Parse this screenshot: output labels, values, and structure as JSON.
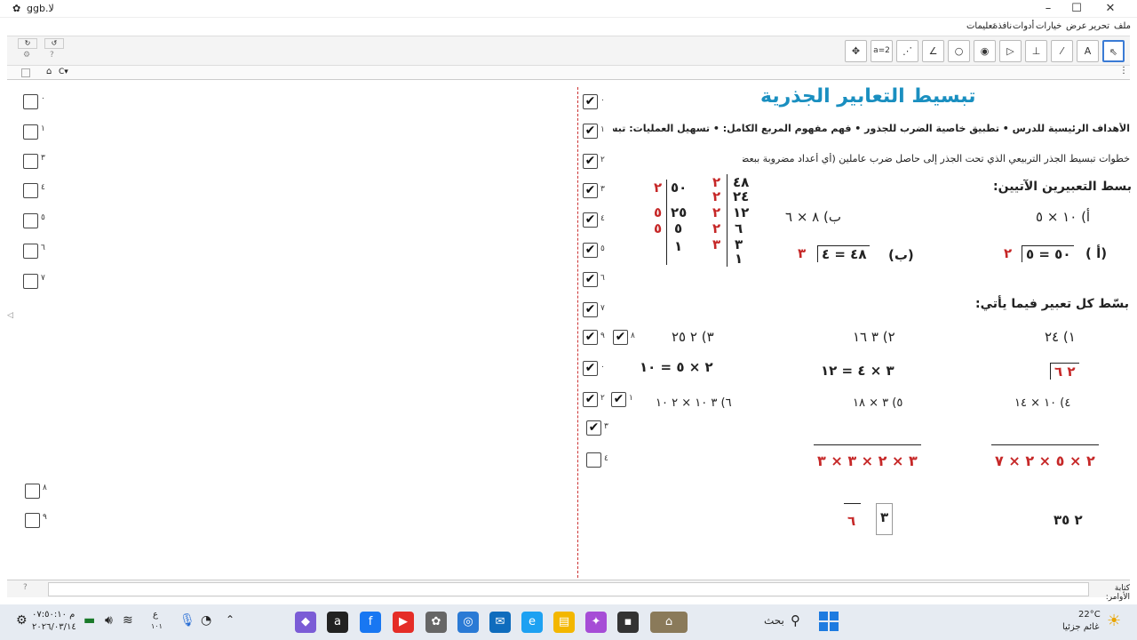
{
  "window": {
    "title": "ggb.لا"
  },
  "menu": [
    "ملف",
    "تحرير",
    "عرض",
    "خيارات",
    "أدوات",
    "نافذة",
    "تعليمات"
  ],
  "toolbar": {
    "tools": [
      {
        "icon": "arrow-pointer-icon",
        "glyph": "⇖"
      },
      {
        "icon": "text-icon",
        "glyph": "A"
      },
      {
        "icon": "segment-icon",
        "glyph": "⁄"
      },
      {
        "icon": "perpendicular-icon",
        "glyph": "⊥"
      },
      {
        "icon": "polygon-icon",
        "glyph": "▷"
      },
      {
        "icon": "circle-icon",
        "glyph": "◉"
      },
      {
        "icon": "circle-point-icon",
        "glyph": "○"
      },
      {
        "icon": "angle-icon",
        "glyph": "∠"
      },
      {
        "icon": "reflect-icon",
        "glyph": "⋰"
      },
      {
        "icon": "slider-icon",
        "glyph": "a=2"
      },
      {
        "icon": "move-view-icon",
        "glyph": "✥"
      }
    ]
  },
  "subbar": {
    "home": "⌂",
    "c_label": "C▾"
  },
  "algebra": {
    "labels": [
      "٠",
      "١",
      "٣",
      "٤",
      "٥",
      "٦",
      "٧",
      "٨",
      "٩"
    ]
  },
  "graphics": {
    "check_labels": [
      "٠",
      "١",
      "٢",
      "٣",
      "٤",
      "٥",
      "٦",
      "٧",
      "٩",
      "٠",
      "٢",
      "٣",
      "٤"
    ],
    "check_extra": [
      "٨",
      "١"
    ],
    "title": "تبسيط التعابير الجذرية",
    "objectives": "الأهداف الرئيسية للدرس   •   تطبيق خاصية الضرب للجذور  •   فهم مفهوم المربع الكامل:  •   تسهيل العمليات:   تبسيط الجذور:",
    "steps": "خطوات تبسيط الجذر التربيعي      الذي تحت الجذر إلى حاصل ضرب عاملين (أي أعداد مضروبة ببعضها).",
    "simplify_two": "بسط التعبيرين الآتيين:",
    "ex_a": "أ)  ١٠ × ٥",
    "ex_b": "ب)  ٨ × ٦",
    "ans_a_left": "(أ )",
    "ans_a_mid": "٥٠ = ٥",
    "ans_a_red": "٢",
    "ans_b_left": "(ب)",
    "ans_b_mid": "٤٨ = ٤",
    "ans_b_red": "٣",
    "factor_48": [
      "٤٨",
      "٢٤",
      "١٢",
      "٦",
      "٣",
      "١"
    ],
    "factor_48_div": [
      "٢",
      "٢",
      "٢",
      "٢",
      "٣"
    ],
    "factor_50": [
      "٥٠",
      "٢٥",
      "٥",
      "١"
    ],
    "factor_50_div": [
      "٢",
      "٥",
      "٥"
    ],
    "simplify_each": "بسّط كل تعبير فيما يأتي:",
    "p1": "١)  ٢٤",
    "p2": "٢)  ٣ ١٦",
    "p3": "٣)  ٢ ٢٥",
    "p1_ans": "٢  ٦",
    "p2_ans": "٣ × ٤ = ١٢",
    "p3_ans": "٢ × ٥ = ١٠",
    "p4": "٤)  ١٠ × ١٤",
    "p5": "٥)  ٣ × ١٨",
    "p6": "٦)  ٣ ١٠ × ٢ ١٠",
    "rad1": "٢ × ٥ × ٢ × ٧",
    "rad2": "٣ × ٢ × ٣ × ٣",
    "fin1": "٢   ٣٥",
    "fin2_box": "٣",
    "fin2": "٦"
  },
  "inputbar": {
    "label": "كتابة الأوامر:",
    "help": "?"
  },
  "taskbar": {
    "search": "بحث",
    "weather_temp": "22°C",
    "weather_text": "غائم جزئيا",
    "time": "م ٠٧:٥٠:١٠",
    "date": "٢٠٢٦/٠٣/١٤",
    "lang": "ع",
    "lang_sub": "١٠١"
  }
}
